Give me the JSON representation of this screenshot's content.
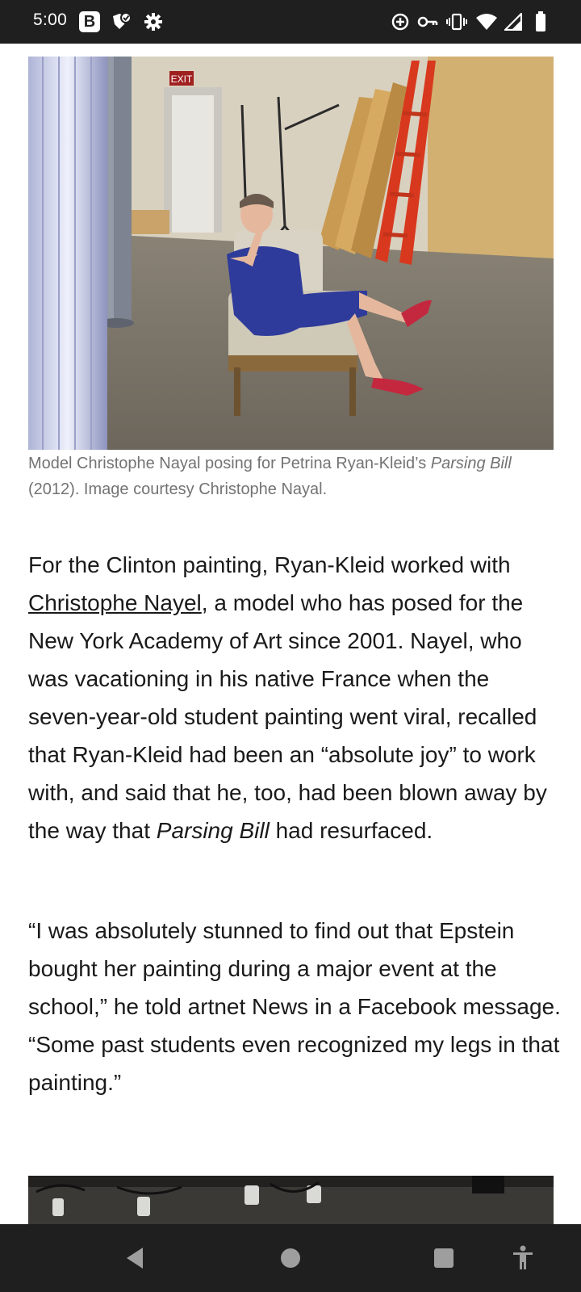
{
  "status_bar": {
    "time": "5:00",
    "left_icons": [
      "b-app-icon",
      "shield-check-icon",
      "settings-gear-icon"
    ],
    "right_icons": [
      "data-saver-icon",
      "vpn-key-icon",
      "vibrate-icon",
      "wifi-icon",
      "signal-icon",
      "battery-icon"
    ],
    "battery_level": 0.85
  },
  "article": {
    "hero_image": {
      "exit_sign": "EXIT"
    },
    "caption": {
      "prefix": "Model Christophe Nayal posing for Petrina Ryan-Kleid’s ",
      "title_italic": "Parsing Bill",
      "suffix": " (2012). Image courtesy Christophe Nayal."
    },
    "paragraph1": {
      "before_link": "For the Clinton painting, Ryan-Kleid worked with ",
      "link_text": "Christophe Nayel",
      "after_link": ", a model who has posed for the New York Academy of Art since 2001. Nayel, who was vacationing in his native France when the seven-year-old student painting went viral, recalled that Ryan-Kleid had been an “absolute joy” to work with, and said that he, too, had been blown away by the way that ",
      "italic": "Parsing Bill",
      "end": " had resurfaced."
    },
    "paragraph2": {
      "text": "“I was absolutely stunned to find out that Epstein bought her painting during a major event at the school,” he told artnet News in a Facebook message. “Some past students even recognized my legs in that painting.”"
    }
  },
  "nav_bar": {
    "buttons": [
      "back",
      "home",
      "recents",
      "accessibility"
    ]
  },
  "colors": {
    "system_bar": "#1f1f1f",
    "text": "#1a1a1a",
    "caption": "#737373",
    "background": "#ffffff"
  }
}
